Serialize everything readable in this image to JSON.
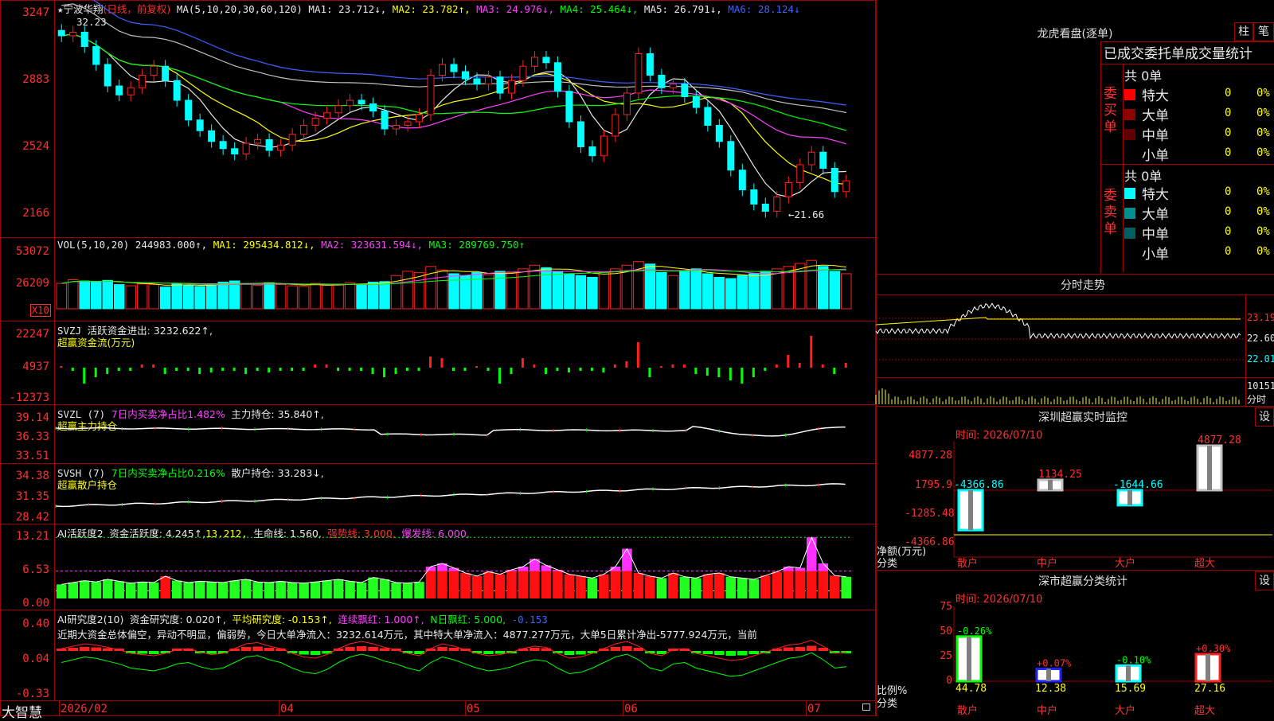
{
  "kline": {
    "title_star": "★",
    "stock_name": "宁波华翔",
    "period": "(日线，前复权)",
    "ma_params": "MA(5,10,20,30,60,120)",
    "ma1": "MA1: 23.712↓,",
    "ma2": "MA2: 23.782↑,",
    "ma3": "MA3: 24.976↓,",
    "ma4": "MA4: 25.464↓,",
    "ma5": "MA5: 26.791↓,",
    "ma6": "MA6: 28.124↓",
    "axis": [
      "3247",
      "2883",
      "2524",
      "2166"
    ],
    "high_mark": "32.23",
    "low_mark": "←21.66",
    "closes": [
      31.8,
      32.0,
      31.2,
      30.2,
      29.0,
      28.5,
      28.9,
      29.6,
      30.1,
      29.3,
      28.2,
      27.1,
      26.5,
      25.9,
      25.5,
      25.2,
      25.8,
      26.0,
      25.4,
      25.7,
      26.3,
      26.8,
      27.2,
      27.5,
      27.9,
      28.2,
      28.0,
      27.6,
      26.6,
      26.8,
      27.0,
      27.4,
      29.6,
      30.2,
      29.8,
      29.4,
      29.1,
      29.5,
      28.6,
      29.3,
      30.1,
      30.6,
      30.3,
      28.7,
      27.0,
      25.6,
      25.1,
      26.2,
      27.4,
      28.6,
      30.8,
      29.6,
      28.9,
      29.1,
      28.4,
      27.8,
      26.8,
      25.9,
      24.3,
      23.2,
      22.4,
      22.0,
      22.8,
      23.6,
      24.6,
      25.3,
      24.4,
      23.1,
      23.7
    ]
  },
  "vol": {
    "label": "VOL(5,10,20)",
    "value": "244983.000↑,",
    "ma1": "MA1: 295434.812↓,",
    "ma2": "MA2: 323631.594↓,",
    "ma3": "MA3: 289769.750↑",
    "axis": [
      "53072",
      "26209"
    ],
    "unit": "X10",
    "bars": [
      0.42,
      0.48,
      0.46,
      0.44,
      0.47,
      0.4,
      0.38,
      0.41,
      0.4,
      0.36,
      0.42,
      0.39,
      0.37,
      0.4,
      0.44,
      0.46,
      0.41,
      0.39,
      0.43,
      0.4,
      0.38,
      0.37,
      0.42,
      0.39,
      0.41,
      0.43,
      0.4,
      0.44,
      0.45,
      0.55,
      0.62,
      0.6,
      0.7,
      0.64,
      0.58,
      0.55,
      0.6,
      0.56,
      0.62,
      0.6,
      0.66,
      0.72,
      0.68,
      0.62,
      0.58,
      0.55,
      0.52,
      0.6,
      0.66,
      0.72,
      0.78,
      0.74,
      0.6,
      0.55,
      0.62,
      0.66,
      0.58,
      0.52,
      0.5,
      0.55,
      0.58,
      0.62,
      0.66,
      0.7,
      0.75,
      0.8,
      0.7,
      0.62,
      0.58
    ]
  },
  "svzj": {
    "label": "SVZJ",
    "text1": "活跃资金进出: 3232.622↑,",
    "text2": "超赢资金流(万元)",
    "axis": [
      "22247",
      "4937",
      "-12373"
    ],
    "bars": [
      0.0,
      -0.1,
      -0.5,
      -0.3,
      -0.2,
      -0.1,
      -0.1,
      0.1,
      0.1,
      -0.2,
      -0.1,
      -0.1,
      -0.2,
      -0.15,
      -0.1,
      -0.1,
      -0.2,
      -0.1,
      -0.15,
      -0.1,
      -0.1,
      -0.1,
      0.1,
      0.1,
      -0.1,
      -0.1,
      -0.1,
      -0.2,
      -0.3,
      -0.2,
      -0.1,
      -0.1,
      0.35,
      0.3,
      -0.1,
      -0.1,
      0.05,
      -0.1,
      -0.5,
      -0.2,
      0.3,
      0.1,
      -0.2,
      -0.1,
      -0.15,
      -0.1,
      -0.1,
      -0.15,
      0.1,
      0.2,
      0.8,
      -0.3,
      0.05,
      0.1,
      0.1,
      -0.2,
      -0.25,
      -0.3,
      -0.4,
      -0.5,
      -0.3,
      -0.1,
      0.1,
      0.4,
      0.15,
      1.0,
      0.1,
      -0.2,
      0.15
    ]
  },
  "svzl": {
    "label": "SVZL (7)",
    "text1": "7日内买卖净占比1.482%",
    "text2": "主力持仓: 35.840↑,",
    "text3": "超赢主力持仓",
    "axis": [
      "39.14",
      "36.33",
      "33.51"
    ]
  },
  "svsh": {
    "label": "SVSH (7)",
    "text1": "7日内买卖净占比0.216%",
    "text2": "散户持仓: 33.283↓,",
    "text3": "超赢散户持仓",
    "axis": [
      "34.38",
      "31.35",
      "28.42"
    ]
  },
  "ai1": {
    "label": "AI活跃度2",
    "text1": "资金活跃度: 4.245↑,",
    "text2": "13.212,",
    "text3": "生命线: 1.560,",
    "text4": "强势线: 3.000,",
    "text5": "爆发线: 6.000,",
    "axis": [
      "13.21",
      "6.53",
      "0.00"
    ],
    "bars": [
      0.22,
      0.25,
      0.28,
      0.26,
      0.3,
      0.27,
      0.24,
      0.26,
      0.25,
      0.35,
      0.28,
      0.25,
      0.27,
      0.26,
      0.25,
      0.28,
      0.3,
      0.26,
      0.25,
      0.27,
      0.25,
      0.24,
      0.26,
      0.28,
      0.3,
      0.27,
      0.25,
      0.33,
      0.3,
      0.25,
      0.24,
      0.26,
      0.5,
      0.55,
      0.48,
      0.4,
      0.35,
      0.42,
      0.38,
      0.45,
      0.5,
      0.62,
      0.52,
      0.45,
      0.38,
      0.35,
      0.32,
      0.38,
      0.5,
      0.78,
      0.4,
      0.35,
      0.32,
      0.4,
      0.34,
      0.32,
      0.38,
      0.4,
      0.34,
      0.32,
      0.3,
      0.36,
      0.42,
      0.5,
      0.48,
      0.96,
      0.55,
      0.36,
      0.34
    ]
  },
  "ai2": {
    "label": "AI研究度2(10)",
    "text1": "资金研究度: 0.020↑,",
    "text2": "平均研究度: -0.153↑,",
    "text3": "连续飘红: 1.000↑,",
    "text4": "N日飘红: 5.000,",
    "text5": "-0.153",
    "axis": [
      "0.40",
      "0.04",
      "-0.33"
    ],
    "comment": "近期大资金总体偏空，异动不明显，偏弱势，今日大单净流入：3232.614万元，其中特大单净流入：4877.277万元，大单5日累计净出-5777.924万元，当前",
    "bars": [
      0.1,
      0.2,
      0.3,
      0.25,
      0.15,
      0.05,
      -0.1,
      -0.15,
      -0.2,
      -0.1,
      0.05,
      0.1,
      -0.05,
      -0.15,
      -0.1,
      0.1,
      0.3,
      0.35,
      0.2,
      0.1,
      -0.1,
      -0.25,
      -0.3,
      -0.15,
      0.1,
      0.3,
      0.4,
      0.3,
      0.15,
      0.05,
      -0.1,
      -0.2,
      0.1,
      0.3,
      0.2,
      0.05,
      -0.1,
      -0.2,
      -0.15,
      -0.05,
      0.1,
      0.2,
      0.15,
      -0.1,
      -0.3,
      -0.25,
      -0.1,
      0.1,
      0.3,
      0.4,
      0.2,
      -0.1,
      -0.2,
      0.05,
      0.1,
      -0.1,
      -0.2,
      -0.3,
      -0.4,
      -0.35,
      -0.2,
      -0.05,
      0.1,
      0.25,
      0.3,
      0.45,
      0.2,
      -0.1,
      -0.05
    ]
  },
  "xaxis": {
    "app": "大智慧",
    "labels": [
      "2026/02",
      "04",
      "05",
      "06",
      "07"
    ]
  },
  "right": {
    "dragon_title": "龙虎看盘(逐单)",
    "btn1": "柱",
    "btn2": "笔",
    "sub_title": "已成交委托单成交量统计",
    "buy_label": "委买单",
    "sell_label": "委卖单",
    "buy_total": "共 0单",
    "sell_total": "共 0单",
    "buy_rows": [
      {
        "name": "特大",
        "val": "0",
        "pct": "0%",
        "color": "#ff0000"
      },
      {
        "name": "大单",
        "val": "0",
        "pct": "0%",
        "color": "#900000"
      },
      {
        "name": "中单",
        "val": "0",
        "pct": "0%",
        "color": "#600000"
      },
      {
        "name": "小单",
        "val": "0",
        "pct": "0%",
        "color": "#000000"
      }
    ],
    "sell_rows": [
      {
        "name": "特大",
        "val": "0",
        "pct": "0%",
        "color": "#00ffff"
      },
      {
        "name": "大单",
        "val": "0",
        "pct": "0%",
        "color": "#009090"
      },
      {
        "name": "中单",
        "val": "0",
        "pct": "0%",
        "color": "#006060"
      },
      {
        "name": "小单",
        "val": "0",
        "pct": "0%",
        "color": "#000000"
      }
    ],
    "fenshi_title": "分时走势",
    "fenshi_axis": [
      "23.19",
      "22.60",
      "22.01"
    ],
    "fenshi_vol_axis": [
      "10151",
      "分时"
    ],
    "sz_title": "深圳超赢实时监控",
    "sz_btn": "设",
    "sz_time": "时间: 2026/07/10",
    "sz_axis": [
      "4877.28",
      "1795.9",
      "-1285.48",
      "-4366.86"
    ],
    "sz_ylabel1": "净额(万元)",
    "sz_ylabel2": "分类",
    "sz_cats": [
      "散户",
      "中户",
      "大户",
      "超大"
    ],
    "sz_vals": [
      "-4366.86",
      "1134.25",
      "-1644.66",
      "4877.28"
    ],
    "sc_title": "深市超赢分类统计",
    "sc_btn": "设",
    "sc_time": "时间: 2026/07/10",
    "sc_axis": [
      "75",
      "50",
      "25",
      "0"
    ],
    "sc_ylabel1": "比例%",
    "sc_ylabel2": "分类",
    "sc_cats": [
      "散户",
      "中户",
      "大户",
      "超大"
    ],
    "sc_vals": [
      "44.78",
      "12.38",
      "15.69",
      "27.16"
    ],
    "sc_chg": [
      "-0.26%",
      "+0.07%",
      "-0.10%",
      "+0.30%"
    ]
  },
  "colors": {
    "up": "#ff2020",
    "down": "#00ffff",
    "frame": "#a00000"
  }
}
